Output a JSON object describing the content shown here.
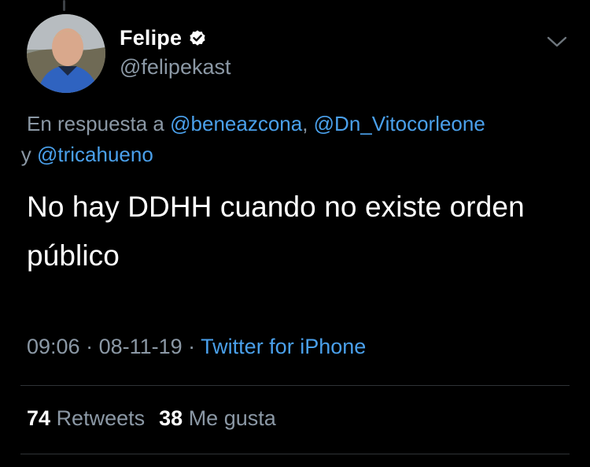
{
  "author": {
    "display_name": "Felipe",
    "handle": "@felipekast",
    "verified": true,
    "avatar_icon": "profile-photo"
  },
  "reply": {
    "prefix": "En respuesta a ",
    "mention_1": "@beneazcona",
    "separator": ", ",
    "mention_2": "@Dn_Vitocorleone",
    "conjunction": " y ",
    "mention_3": "@tricahueno"
  },
  "tweet": {
    "text": "No hay DDHH cuando no existe orden público"
  },
  "meta": {
    "time": "09:06",
    "dot": " · ",
    "date": "08-11-19",
    "source": "Twitter for iPhone"
  },
  "stats": {
    "retweets_count": "74",
    "retweets_label": "Retweets",
    "likes_count": "38",
    "likes_label": "Me gusta"
  },
  "colors": {
    "background": "#000000",
    "text": "#ffffff",
    "secondary": "#8b98a5",
    "link": "#4aa0eb",
    "divider": "#2f3336"
  }
}
